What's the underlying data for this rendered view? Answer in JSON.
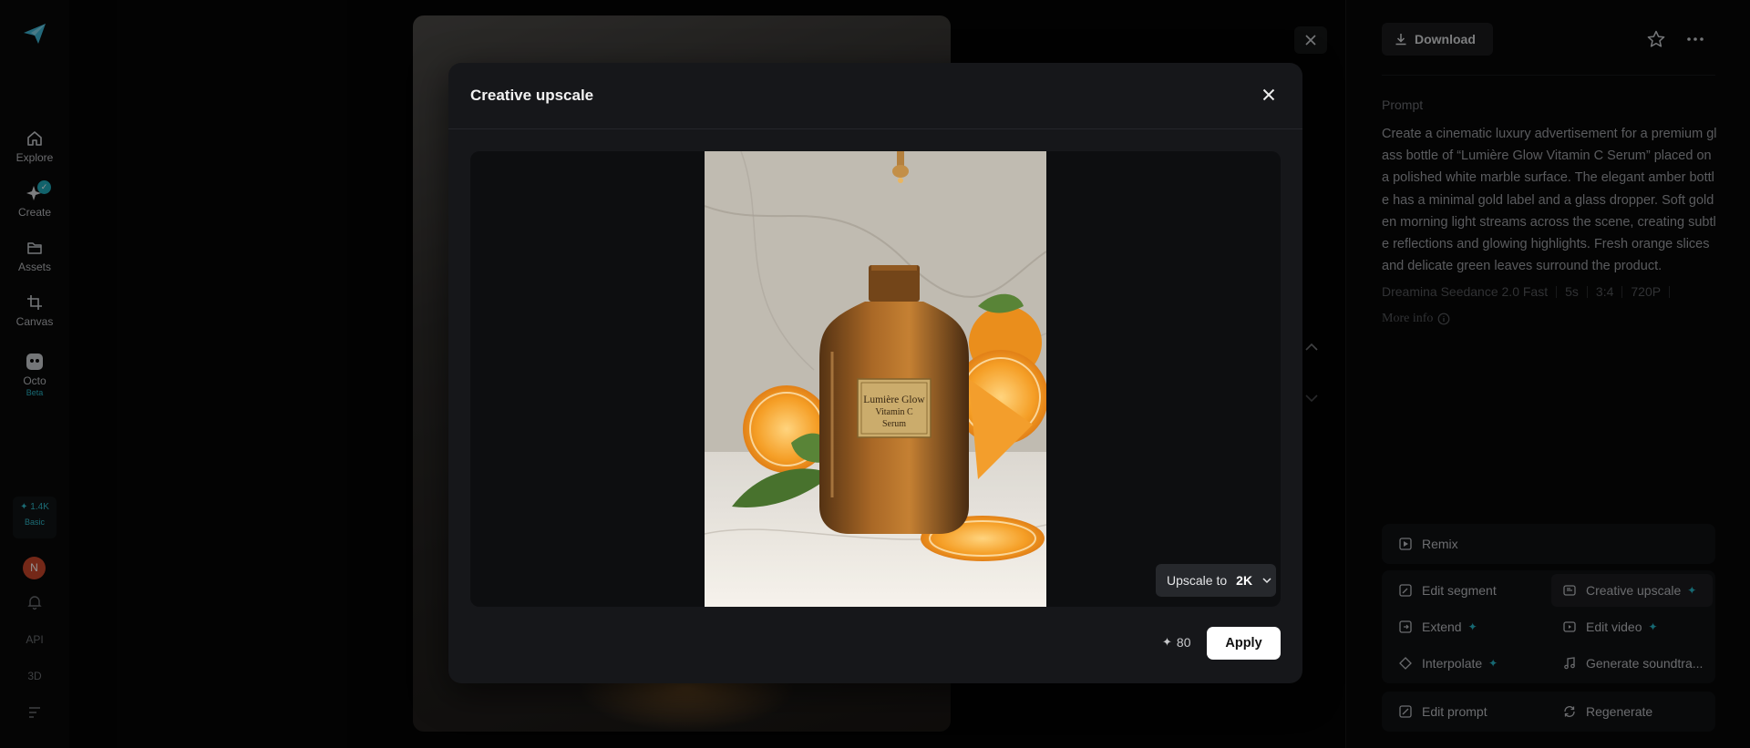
{
  "sidebar": {
    "items": [
      {
        "label": "Explore",
        "icon": "home-icon"
      },
      {
        "label": "Create",
        "icon": "sparkle-icon"
      },
      {
        "label": "Assets",
        "icon": "folder-icon"
      },
      {
        "label": "Canvas",
        "icon": "crop-icon"
      },
      {
        "label": "Octo",
        "icon": "octo-icon",
        "badge": "Beta"
      }
    ],
    "credits": {
      "amount": "1.4K",
      "plan": "Basic"
    },
    "avatar_initial": "N",
    "api_label": "API",
    "threed_label": "3D"
  },
  "header": {
    "download_label": "Download"
  },
  "details": {
    "prompt_label": "Prompt",
    "prompt_text": "Create a cinematic luxury advertisement for a premium glass bottle of “Lumière Glow Vitamin C Serum” placed on a polished white marble surface. The elegant amber bottle has a minimal gold label and a glass dropper. Soft golden morning light streams across the scene, creating subtle reflections and glowing highlights. Fresh orange slices and delicate green leaves surround the product.",
    "meta": [
      "Dreamina Seedance 2.0 Fast",
      "5s",
      "3:4",
      "720P"
    ],
    "more_info": "More info"
  },
  "actions": {
    "remix": "Remix",
    "edit_segment": "Edit segment",
    "creative_upscale": "Creative upscale",
    "extend": "Extend",
    "edit_video": "Edit video",
    "interpolate": "Interpolate",
    "generate_soundtrack": "Generate soundtra...",
    "edit_prompt": "Edit prompt",
    "regenerate": "Regenerate"
  },
  "modal": {
    "title": "Creative upscale",
    "product_label": {
      "line1": "Lumière Glow",
      "line2": "Vitamin C",
      "line3": "Serum"
    },
    "upscale_prefix": "Upscale to",
    "upscale_value": "2K",
    "cost": "80",
    "apply_label": "Apply"
  },
  "colors": {
    "accent": "#27b4c4",
    "avatar": "#c8452a",
    "modal_bg": "#16171a"
  }
}
